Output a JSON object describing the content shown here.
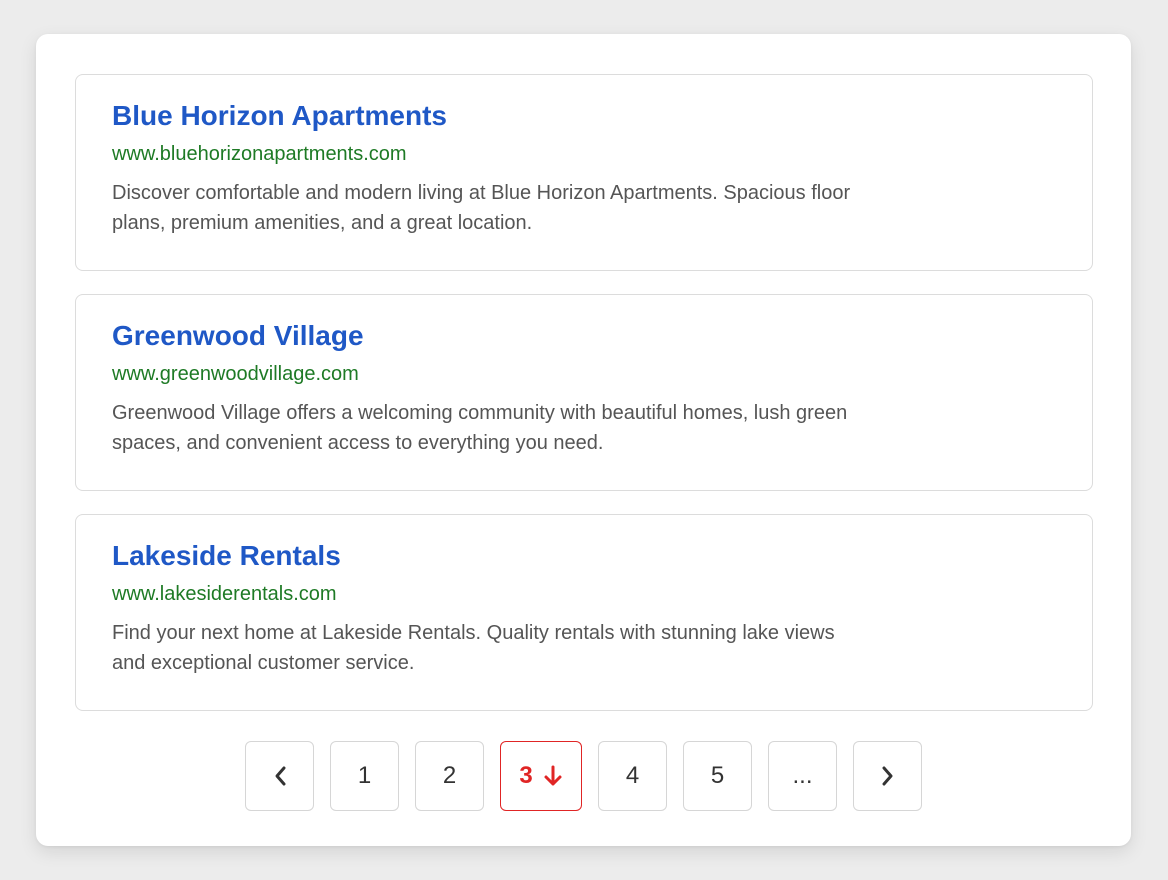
{
  "results": [
    {
      "title": "Blue Horizon Apartments",
      "url": "www.bluehorizonapartments.com",
      "description": "Discover comfortable and modern living at Blue Horizon Apartments. Spacious floor plans, premium amenities, and a great location."
    },
    {
      "title": "Greenwood Village",
      "url": "www.greenwoodvillage.com",
      "description": "Greenwood Village offers a welcoming community with beautiful homes, lush green spaces, and convenient access to everything you need."
    },
    {
      "title": "Lakeside Rentals",
      "url": "www.lakesiderentals.com",
      "description": "Find your next home at Lakeside Rentals. Quality rentals with stunning lake views and exceptional customer service."
    }
  ],
  "pagination": {
    "prev_icon": "chevron-left-icon",
    "next_icon": "chevron-right-icon",
    "pages": [
      "1",
      "2",
      "3",
      "4",
      "5"
    ],
    "current": "3",
    "current_icon": "arrow-down-icon",
    "ellipsis": "...",
    "colors": {
      "active": "#e02525",
      "title": "#1f58c6",
      "url": "#1e7a25"
    }
  }
}
